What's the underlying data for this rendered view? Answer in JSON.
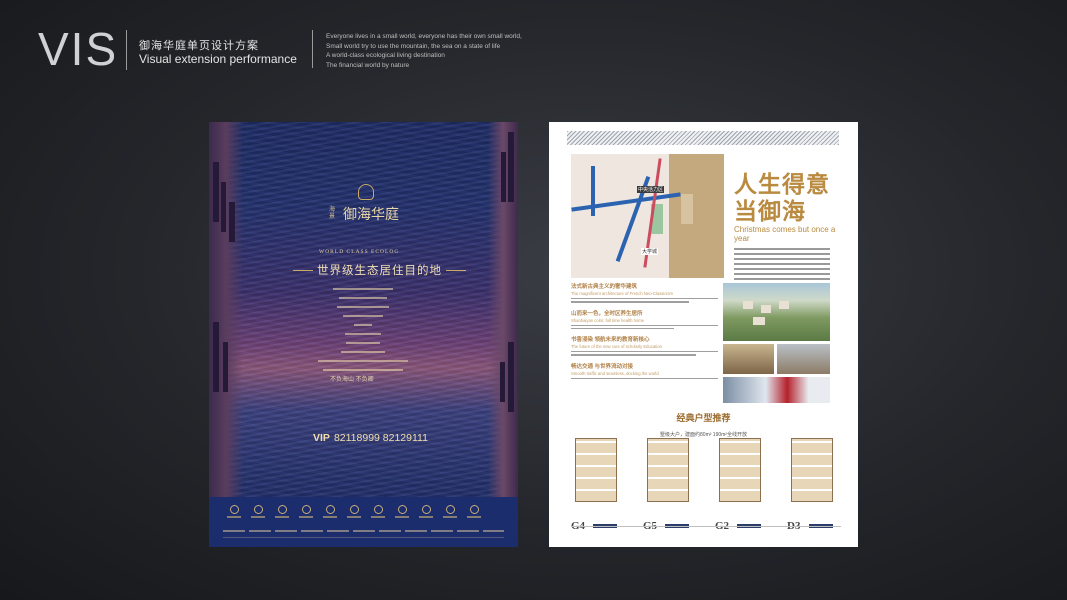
{
  "header": {
    "logo": "VIS",
    "title_cn": "御海华庭单页设计方案",
    "title_en": "Visual extension performance",
    "tagline": [
      "Everyone lives in a small world, everyone has their own small world,",
      "Small world try to use the mountain, the sea on a state of life",
      "A world-class ecological living destination",
      "The financial world by nature"
    ]
  },
  "left_poster": {
    "brand_small": "海景",
    "brand_name": "御海华庭",
    "world_en": "WORLD CLASS ECOLOG",
    "world_cn": "世界级生态居住目的地",
    "slogan": "不负海山 不负卿",
    "phone_prefix": "VIP",
    "phone": "82118999 82129111"
  },
  "right_poster": {
    "map_labels": [
      "中央活力区",
      "大学城"
    ],
    "title_cn": "人生得意当御海",
    "title_en": "Christmas comes but once a year",
    "sections": [
      {
        "title": "法式新古典主义的奢华建筑",
        "en": "The magnificent architecture of French Neo-Classicism"
      },
      {
        "title": "山而来一色，全时区养生居所",
        "en": "Shanhaiyan color, full time health home"
      },
      {
        "title": "书香浸染 领航未来的教育新核心",
        "en": "The future of the new core of scholarly Education"
      },
      {
        "title": "畅达交通 与世界流动对接",
        "en": "Smooth traffic and seamless, docking the world"
      }
    ],
    "floor_title": "经典户型推荐",
    "floor_desc": "墅级大户，建面约80m² 190m²全线开放",
    "plans": [
      "G4",
      "G5",
      "G2",
      "D3"
    ]
  }
}
